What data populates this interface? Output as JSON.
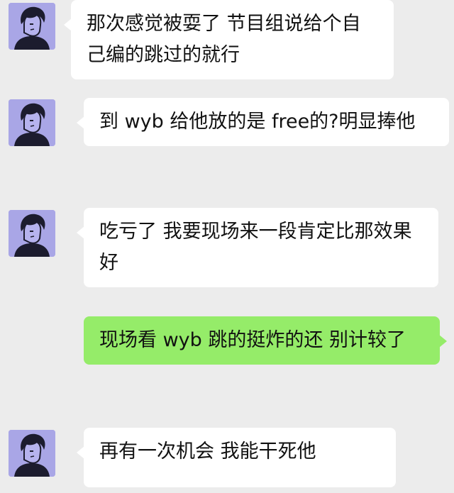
{
  "colors": {
    "background": "#ececec",
    "bubble_incoming": "#ffffff",
    "bubble_outgoing": "#95ec69",
    "avatar_background": "#a9a6e6"
  },
  "messages": [
    {
      "side": "left",
      "text": "那次感觉被耍了 节目组说给个自己编的跳过的就行"
    },
    {
      "side": "left",
      "text": "到 wyb 给他放的是 free的?明显捧他"
    },
    {
      "side": "left",
      "text": "吃亏了  我要现场来一段肯定比那效果好"
    },
    {
      "side": "right",
      "text": "现场看 wyb 跳的挺炸的还  别计较了"
    },
    {
      "side": "left",
      "text": "再有一次机会   我能干死他"
    }
  ]
}
